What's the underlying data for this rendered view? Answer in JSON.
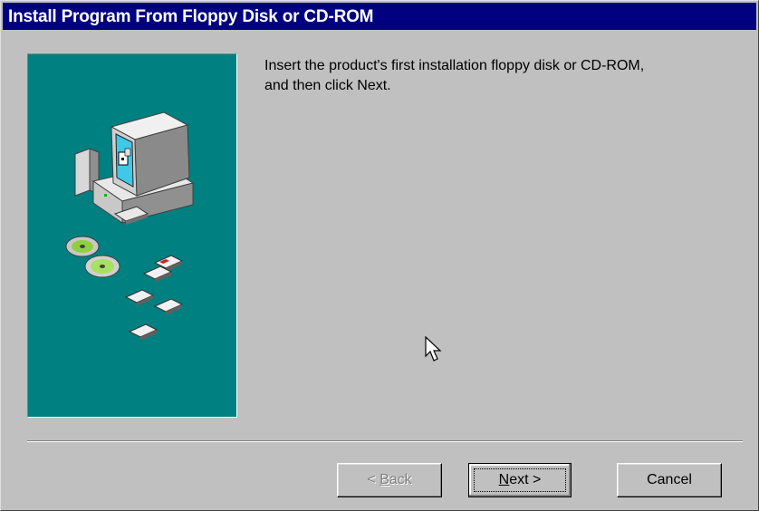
{
  "window": {
    "title": "Install Program From Floppy Disk or CD-ROM"
  },
  "content": {
    "instruction_line1": "Insert the product's first installation floppy disk or CD-ROM,",
    "instruction_line2": "and then click Next."
  },
  "buttons": {
    "back": {
      "prefix": "< ",
      "mnemonic": "B",
      "rest": "ack",
      "enabled": false
    },
    "next": {
      "mnemonic": "N",
      "rest": "ext >",
      "enabled": true,
      "default": true
    },
    "cancel": {
      "label": "Cancel",
      "enabled": true
    }
  },
  "colors": {
    "title_bar": "#000080",
    "dialog_face": "#c0c0c0",
    "art_background": "#008080"
  },
  "icons": [
    "computer-icon",
    "cd-rom-icon",
    "floppy-disk-icon",
    "mouse-cursor-icon"
  ]
}
